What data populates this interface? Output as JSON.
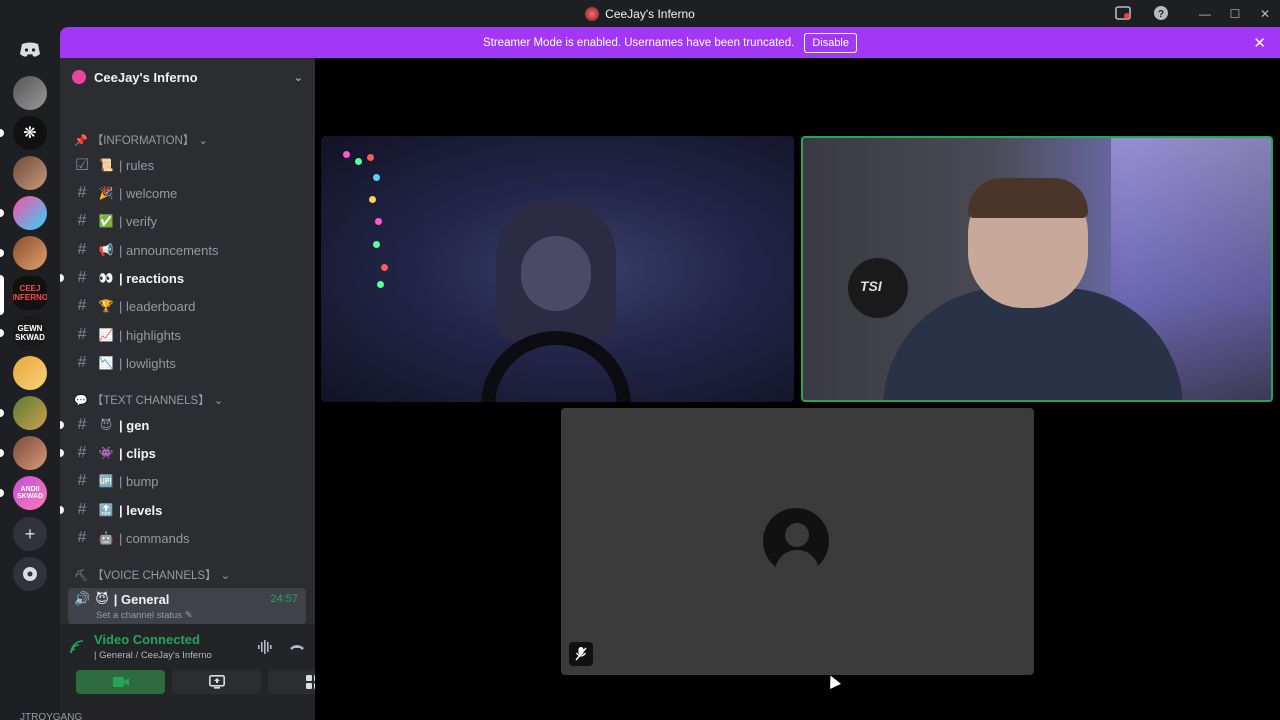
{
  "window": {
    "title": "CeeJay's Inferno"
  },
  "banner": {
    "message": "Streamer Mode is enabled. Usernames have been truncated.",
    "disable_label": "Disable"
  },
  "server": {
    "name": "CeeJay's Inferno"
  },
  "categories": [
    {
      "label": "【INFORMATION】",
      "icon": "pin-icon"
    },
    {
      "label": "【TEXT CHANNELS】",
      "icon": "speech-bubble-icon"
    },
    {
      "label": "【VOICE CHANNELS】",
      "icon": "pickaxe-icon"
    }
  ],
  "channels": [
    {
      "name": "| rules",
      "emoji": "📜",
      "unread": false,
      "type": "rules"
    },
    {
      "name": "| welcome",
      "emoji": "🎉",
      "unread": false,
      "type": "text"
    },
    {
      "name": "| verify",
      "emoji": "✅",
      "unread": false,
      "type": "text"
    },
    {
      "name": "| announcements",
      "emoji": "📢",
      "unread": false,
      "type": "text"
    },
    {
      "name": "| reactions",
      "emoji": "👀",
      "unread": true,
      "type": "text"
    },
    {
      "name": "| leaderboard",
      "emoji": "🏆",
      "unread": false,
      "type": "text"
    },
    {
      "name": "| highlights",
      "emoji": "📈",
      "unread": false,
      "type": "text"
    },
    {
      "name": "| lowlights",
      "emoji": "📉",
      "unread": false,
      "type": "text"
    },
    {
      "name": "| gen",
      "emoji": "😈",
      "unread": true,
      "type": "text"
    },
    {
      "name": "| clips",
      "emoji": "👾",
      "unread": true,
      "type": "text"
    },
    {
      "name": "| bump",
      "emoji": "🆙",
      "unread": false,
      "type": "text"
    },
    {
      "name": "| levels",
      "emoji": "🔝",
      "unread": true,
      "type": "text"
    },
    {
      "name": "| commands",
      "emoji": "🤖",
      "unread": false,
      "type": "text"
    }
  ],
  "voice_channel": {
    "name": "| General",
    "emoji": "😈",
    "timer": "24:57",
    "status": "Set a channel status"
  },
  "voice_panel": {
    "label": "Video Connected",
    "sub": "| General / CeeJay's Inferno"
  },
  "user_strip": "JTROYGANG",
  "colors": {
    "banner": "#a238f5",
    "connected": "#23a55a",
    "sidebar": "#2b2d31",
    "rail": "#1e1f22"
  }
}
